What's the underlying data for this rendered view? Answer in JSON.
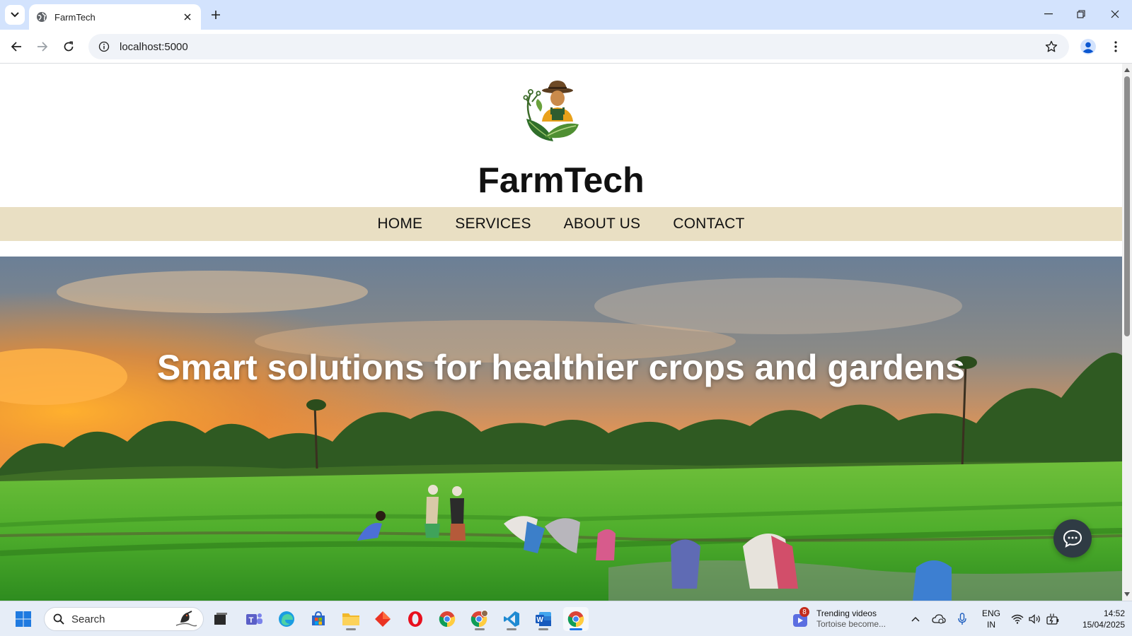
{
  "browser": {
    "tab_title": "FarmTech",
    "url": "localhost:5000"
  },
  "site": {
    "title": "FarmTech",
    "nav": [
      {
        "label": "HOME"
      },
      {
        "label": "SERVICES"
      },
      {
        "label": "ABOUT US"
      },
      {
        "label": "CONTACT"
      }
    ],
    "hero_text": "Smart solutions for healthier crops and gardens"
  },
  "taskbar": {
    "search_label": "Search",
    "news_badge": "8",
    "news_title": "Trending videos",
    "news_sub": "Tortoise become...",
    "lang_line1": "ENG",
    "lang_line2": "IN",
    "time": "14:52",
    "date": "15/04/2025"
  },
  "colors": {
    "tabbar": "#d3e3fd",
    "site_nav_bg": "#e9dfc3",
    "chat_button": "#2f3b44"
  }
}
